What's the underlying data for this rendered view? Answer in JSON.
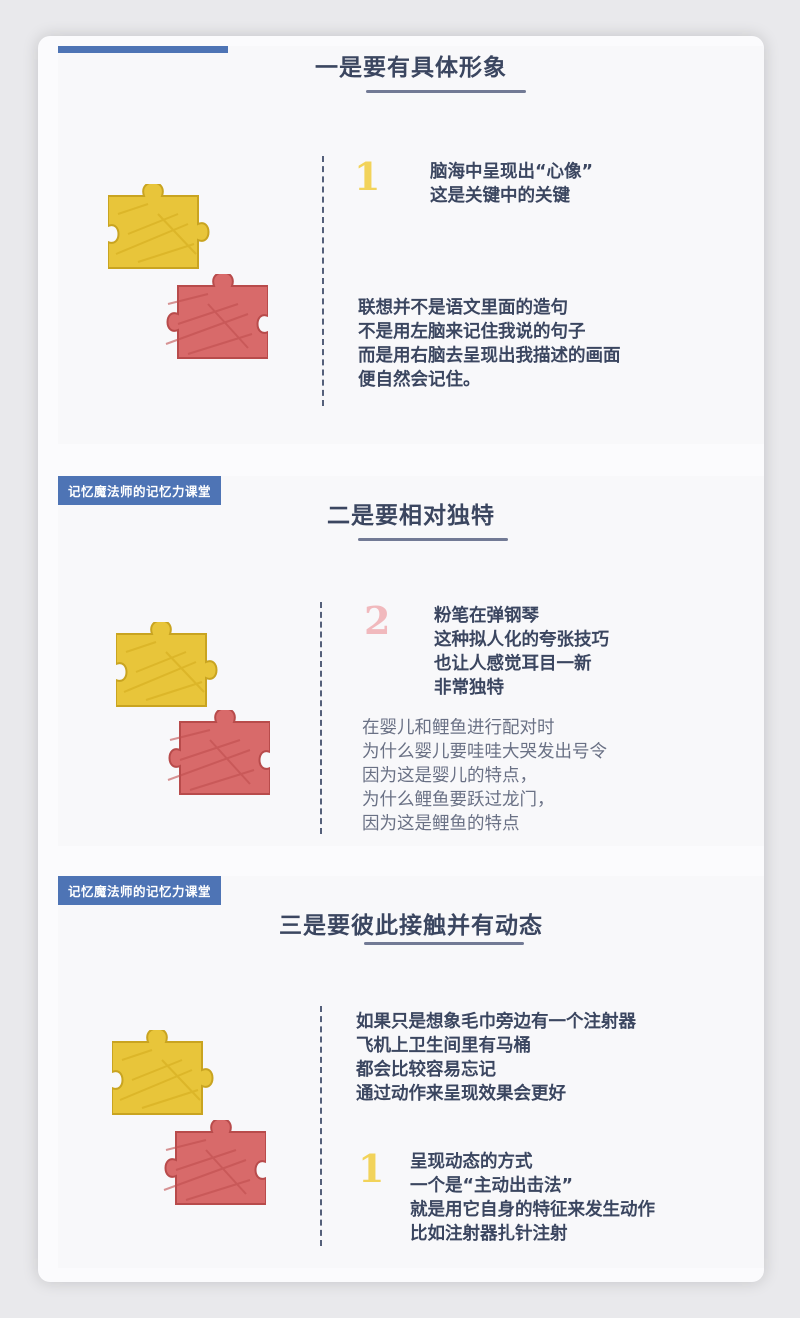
{
  "brand": {
    "tag_label": "记忆魔法师的记忆力课堂",
    "accent": "#4e74b5"
  },
  "slides": [
    {
      "title": "一是要有具体形象",
      "number": "1",
      "highlight": [
        "脑海中呈现出“心像”",
        "这是关键中的关键"
      ],
      "body": [
        "联想并不是语文里面的造句",
        "不是用左脑来记住我说的句子",
        "而是用右脑去呈现出我描述的画面",
        "便自然会记住。"
      ]
    },
    {
      "title": "二是要相对独特",
      "number": "2",
      "highlight": [
        "粉笔在弹钢琴",
        "这种拟人化的夸张技巧",
        "也让人感觉耳目一新",
        "非常独特"
      ],
      "body": [
        "在婴儿和鲤鱼进行配对时",
        "为什么婴儿要哇哇大哭发出号令",
        "因为这是婴儿的特点，",
        "为什么鲤鱼要跃过龙门，",
        "因为这是鲤鱼的特点"
      ]
    },
    {
      "title": "三是要彼此接触并有动态",
      "number": "1",
      "body": [
        "如果只是想象毛巾旁边有一个注射器",
        "飞机上卫生间里有马桶",
        "都会比较容易忘记",
        "通过动作来呈现效果会更好"
      ],
      "highlight": [
        "呈现动态的方式",
        "一个是“主动出击法”",
        "就是用它自身的特征来发生动作",
        "比如注射器扎针注射"
      ]
    }
  ],
  "colors": {
    "puzzle_yellow": "#e8c53a",
    "puzzle_red": "#d86a6a",
    "text": "#3b4660"
  }
}
